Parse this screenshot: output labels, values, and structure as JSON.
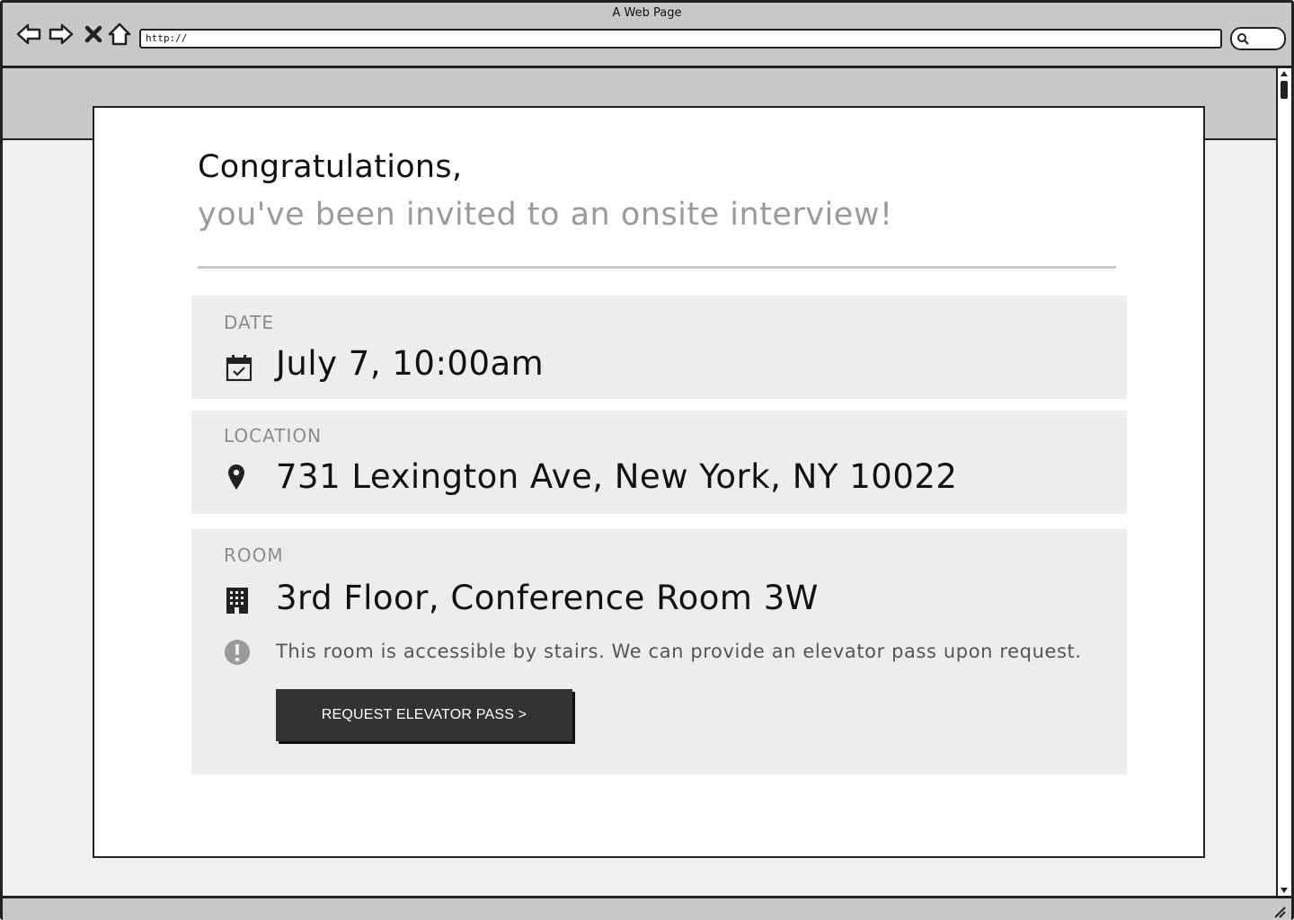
{
  "window": {
    "title": "A Web Page",
    "address": "http://"
  },
  "invitation": {
    "heading": "Congratulations,",
    "subheading": "you've been invited to an onsite interview!"
  },
  "date": {
    "label": "DATE",
    "value": "July 7, 10:00am",
    "icon": "calendar-check-icon"
  },
  "location": {
    "label": "LOCATION",
    "value": "731 Lexington Ave, New York, NY 10022",
    "icon": "map-pin-icon"
  },
  "room": {
    "label": "ROOM",
    "value": "3rd Floor, Conference Room 3W",
    "icon": "building-icon",
    "note": "This room is accessible by stairs. We can provide an elevator pass upon request.",
    "note_icon": "exclamation-circle-icon",
    "button_label": "REQUEST ELEVATOR PASS >"
  },
  "colors": {
    "section_background": "#ededed",
    "muted_text": "#9a9a9a",
    "button_background": "#333333",
    "chrome_gray": "#c8c8c8"
  }
}
